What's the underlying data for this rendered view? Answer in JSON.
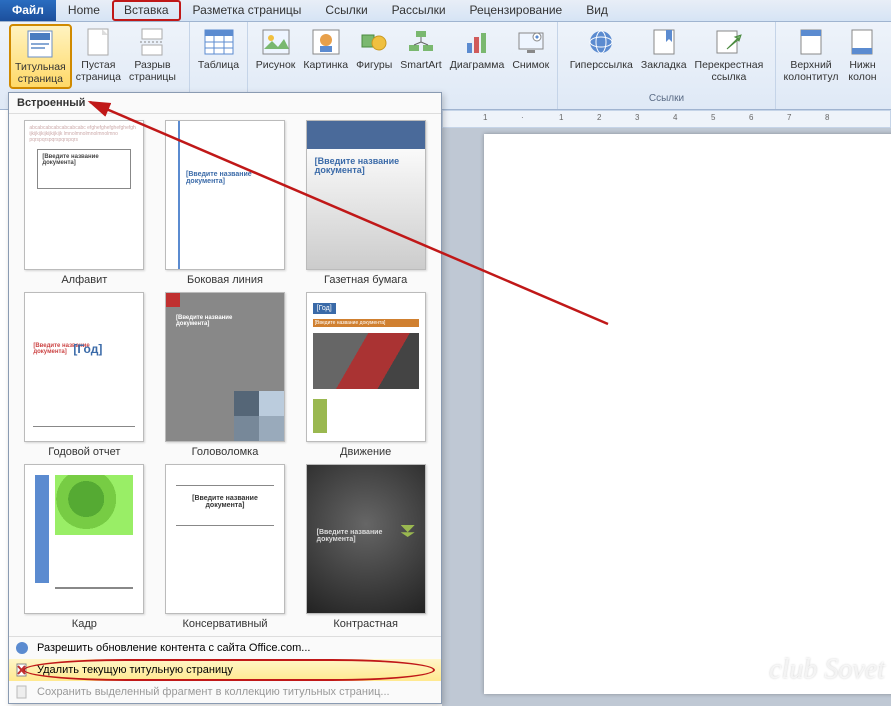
{
  "tabs": {
    "file": "Файл",
    "home": "Home",
    "insert": "Вставка",
    "layout": "Разметка страницы",
    "refs": "Ссылки",
    "mail": "Рассылки",
    "review": "Рецензирование",
    "view": "Вид"
  },
  "ribbon": {
    "pages": {
      "cover": "Титульная\nстраница",
      "blank": "Пустая\nстраница",
      "break": "Разрыв\nстраницы"
    },
    "table": "Таблица",
    "illus": {
      "picture": "Рисунок",
      "clip": "Картинка",
      "shapes": "Фигуры",
      "smartart": "SmartArt",
      "chart": "Диаграмма",
      "screenshot": "Снимок"
    },
    "links": {
      "hyper": "Гиперссылка",
      "bookmark": "Закладка",
      "cross": "Перекрестная\nссылка",
      "group": "Ссылки"
    },
    "header_footer": {
      "header": "Верхний\nколонтитул",
      "footer": "Нижн\nколон"
    }
  },
  "gallery": {
    "header": "Встроенный",
    "items": [
      {
        "label": "Алфавит"
      },
      {
        "label": "Боковая линия"
      },
      {
        "label": "Газетная бумага"
      },
      {
        "label": "Годовой отчет"
      },
      {
        "label": "Головоломка"
      },
      {
        "label": "Движение"
      },
      {
        "label": "Кадр"
      },
      {
        "label": "Консервативный"
      },
      {
        "label": "Контрастная"
      }
    ],
    "thumb_text": {
      "doc_title": "[Введите название документа]",
      "doc_title_short": "[Введите название\nдокумента]",
      "year": "[Год]"
    },
    "footer": {
      "office": "Разрешить обновление контента с сайта Office.com...",
      "del": "Удалить текущую титульную страницу",
      "save": "Сохранить выделенный фрагмент в коллекцию титульных страниц..."
    }
  },
  "ruler": {
    "marks": [
      "1",
      "1",
      "2",
      "3",
      "4",
      "5",
      "6",
      "7",
      "8"
    ]
  },
  "watermark": "club Sovet"
}
